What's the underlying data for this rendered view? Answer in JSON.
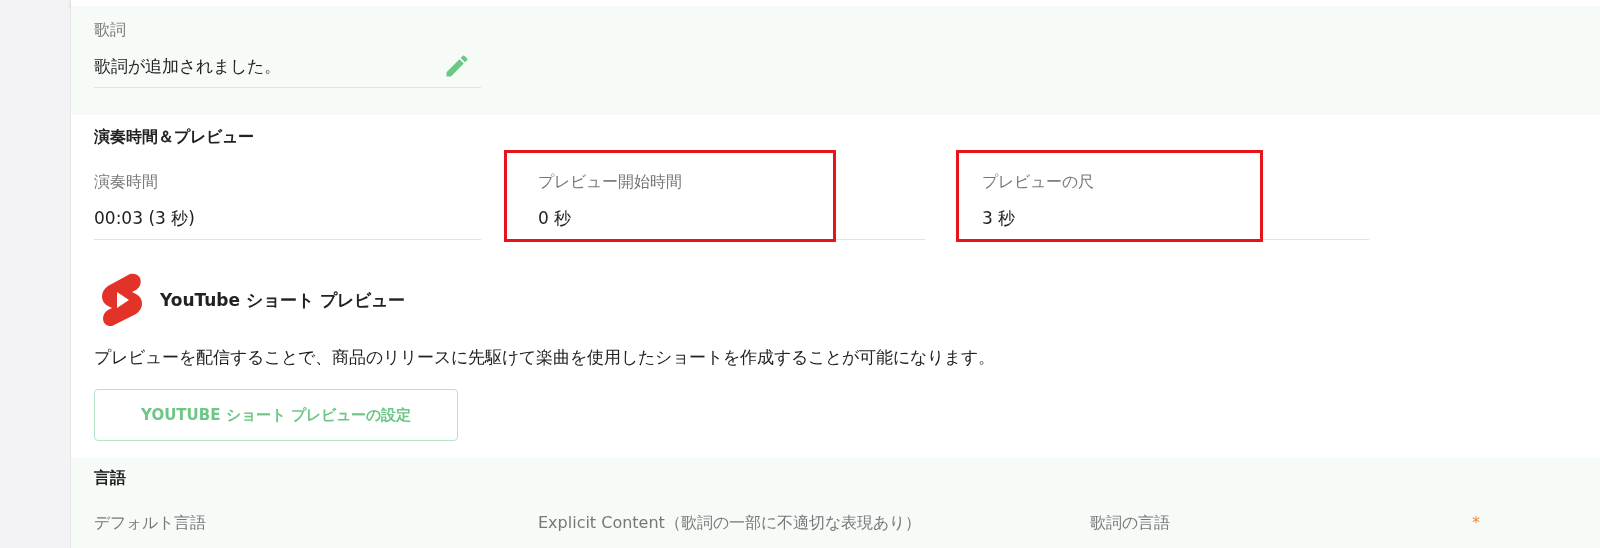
{
  "lyrics": {
    "label": "歌詞",
    "value": "歌詞が追加されました。",
    "editable": true
  },
  "duration_section": {
    "heading": "演奏時間＆プレビュー",
    "fields": [
      {
        "label": "演奏時間",
        "value": "00:03 (3 秒)",
        "highlighted": false
      },
      {
        "label": "プレビュー開始時間",
        "value": "0 秒",
        "highlighted": true
      },
      {
        "label": "プレビューの尺",
        "value": "3 秒",
        "highlighted": true
      }
    ]
  },
  "shorts_preview": {
    "title": "YouTube ショート プレビュー",
    "description": "プレビューを配信することで、商品のリリースに先駆けて楽曲を使用したショートを作成することが可能になります。",
    "button": "YOUTUBE ショート プレビューの設定"
  },
  "language_section": {
    "heading": "言語",
    "fields": [
      {
        "label": "デフォルト言語",
        "required": false
      },
      {
        "label": "Explicit Content（歌詞の一部に不適切な表現あり）",
        "required": false
      },
      {
        "label": "歌詞の言語",
        "required": true
      }
    ],
    "required_mark": "*"
  }
}
